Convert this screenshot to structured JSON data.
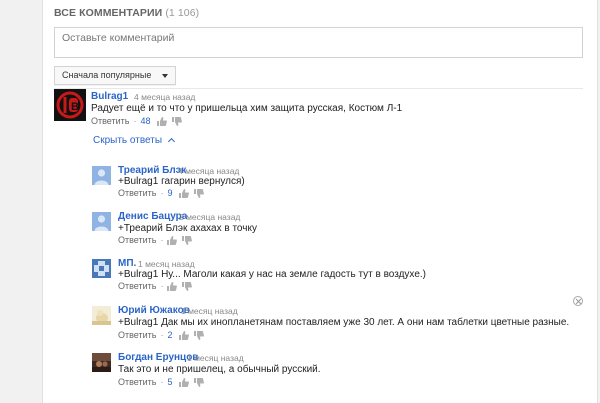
{
  "header": {
    "title": "ВСЕ КОММЕНТАРИИ",
    "count": "(1 106)"
  },
  "comment_input": {
    "placeholder": "Оставьте комментарий"
  },
  "sort": {
    "label": "Сначала популярные"
  },
  "replies_toggle": "Скрыть ответы",
  "actions": {
    "reply_label": "Ответить",
    "separator": "·"
  },
  "top_comment": {
    "author": "Bulrag1",
    "time": "4 месяца назад",
    "text": "Радует ещё и то что у пришельца  хим защита русская,  Костюм Л-1",
    "likes": "48"
  },
  "replies": [
    {
      "author": "Треарий Блэк",
      "time": "4 месяца назад",
      "text": "+Bulrag1 гагарин вернулся)",
      "likes": "9"
    },
    {
      "author": "Денис Бацура",
      "time": "2 месяца назад",
      "text": "+Треарий Блэк ахахах в точку",
      "likes": ""
    },
    {
      "author": "МП.",
      "time": "1 месяц назад",
      "text": "+Bulrag1 Ну... Маголи какая у нас на земле гадость тут в воздухе.)",
      "likes": ""
    },
    {
      "author": "Юрий Южаков",
      "time": "1 месяц назад",
      "text": "+Bulrag1 Дак мы их инопланетянам поставляем уже 30 лет. А они нам таблетки цветные разные.",
      "likes": "2"
    },
    {
      "author": "Богдан Ерунцов",
      "time": "1 месяц назад",
      "text": "Так это и не пришелец, а обычный русский.",
      "likes": "5"
    }
  ]
}
